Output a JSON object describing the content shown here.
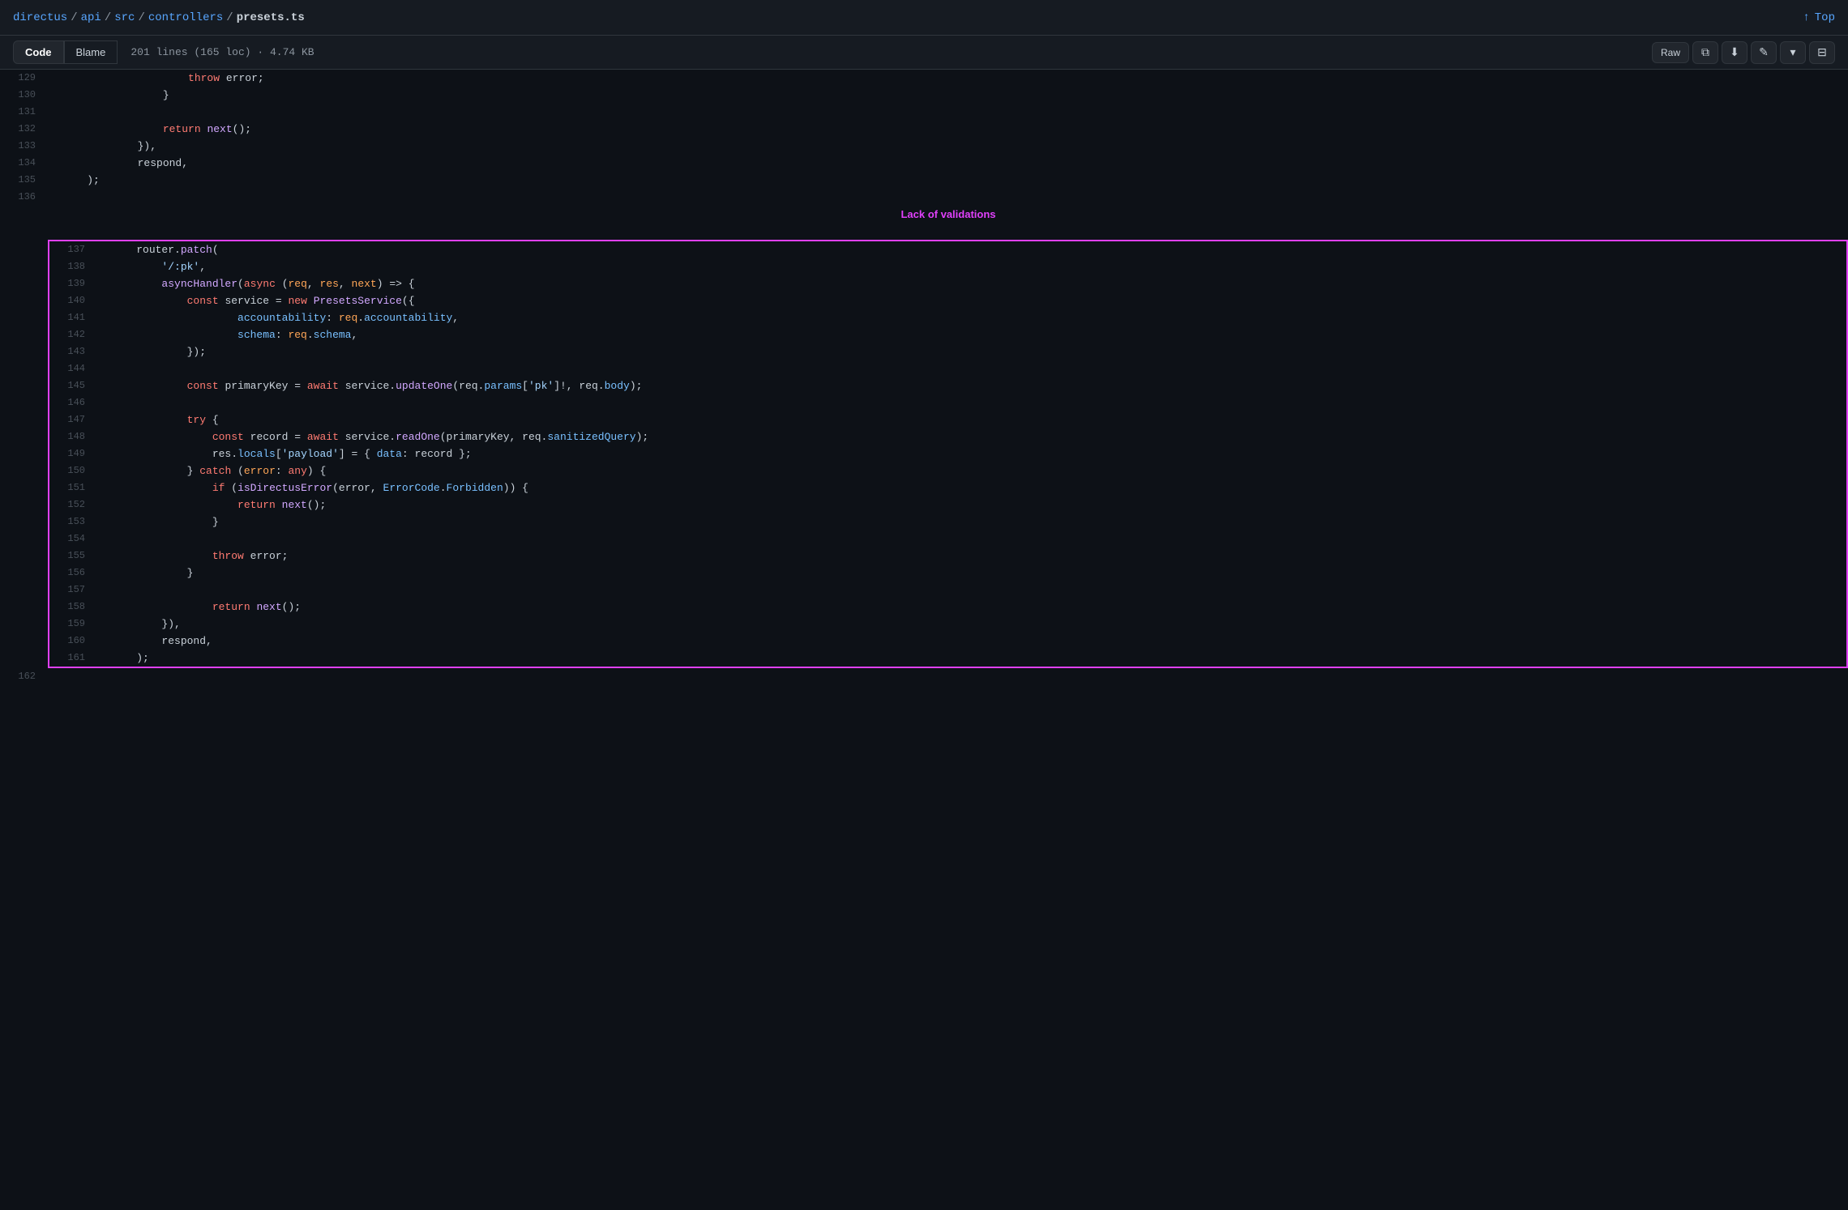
{
  "nav": {
    "breadcrumb": [
      {
        "label": "directus",
        "href": "#"
      },
      {
        "sep": "/"
      },
      {
        "label": "api",
        "href": "#"
      },
      {
        "sep": "/"
      },
      {
        "label": "src",
        "href": "#"
      },
      {
        "sep": "/"
      },
      {
        "label": "controllers",
        "href": "#"
      },
      {
        "sep": "/"
      },
      {
        "label": "presets.ts",
        "current": true
      }
    ],
    "top_link": "Top",
    "top_icon": "↑"
  },
  "toolbar": {
    "tab_code": "Code",
    "tab_blame": "Blame",
    "file_meta": "201 lines (165 loc) · 4.74 KB",
    "raw_btn": "Raw",
    "copy_icon": "⧉",
    "download_icon": "↓",
    "edit_icon": "✎",
    "dropdown_icon": "▾",
    "symbol_icon": "⊞"
  },
  "annotation": {
    "label": "Lack of validations"
  },
  "lines": [
    {
      "num": 129,
      "code": "                    throw error;",
      "highlight": false
    },
    {
      "num": 130,
      "code": "                }",
      "highlight": false
    },
    {
      "num": 131,
      "code": "",
      "highlight": false
    },
    {
      "num": 132,
      "code": "                return next();",
      "highlight": false
    },
    {
      "num": 133,
      "code": "            }),",
      "highlight": false
    },
    {
      "num": 134,
      "code": "            respond,",
      "highlight": false
    },
    {
      "num": 135,
      "code": "    );",
      "highlight": false
    },
    {
      "num": 136,
      "code": "",
      "highlight": false
    },
    {
      "num": 137,
      "code": "    router.patch(",
      "highlight": true,
      "box_start": true
    },
    {
      "num": 138,
      "code": "        '/:pk',",
      "highlight": true
    },
    {
      "num": 139,
      "code": "        asyncHandler(async (req, res, next) => {",
      "highlight": true
    },
    {
      "num": 140,
      "code": "            const service = new PresetsService({",
      "highlight": true
    },
    {
      "num": 141,
      "code": "                    accountability: req.accountability,",
      "highlight": true
    },
    {
      "num": 142,
      "code": "                    schema: req.schema,",
      "highlight": true
    },
    {
      "num": 143,
      "code": "            });",
      "highlight": true
    },
    {
      "num": 144,
      "code": "",
      "highlight": true
    },
    {
      "num": 145,
      "code": "            const primaryKey = await service.updateOne(req.params['pk']!, req.body);",
      "highlight": true
    },
    {
      "num": 146,
      "code": "",
      "highlight": true
    },
    {
      "num": 147,
      "code": "            try {",
      "highlight": true
    },
    {
      "num": 148,
      "code": "                const record = await service.readOne(primaryKey, req.sanitizedQuery);",
      "highlight": true
    },
    {
      "num": 149,
      "code": "                res.locals['payload'] = { data: record };",
      "highlight": true
    },
    {
      "num": 150,
      "code": "            } catch (error: any) {",
      "highlight": true
    },
    {
      "num": 151,
      "code": "                if (isDirectusError(error, ErrorCode.Forbidden)) {",
      "highlight": true
    },
    {
      "num": 152,
      "code": "                    return next();",
      "highlight": true
    },
    {
      "num": 153,
      "code": "                }",
      "highlight": true
    },
    {
      "num": 154,
      "code": "",
      "highlight": true
    },
    {
      "num": 155,
      "code": "                throw error;",
      "highlight": true
    },
    {
      "num": 156,
      "code": "            }",
      "highlight": true
    },
    {
      "num": 157,
      "code": "",
      "highlight": true
    },
    {
      "num": 158,
      "code": "                return next();",
      "highlight": true
    },
    {
      "num": 159,
      "code": "        }),",
      "highlight": true
    },
    {
      "num": 160,
      "code": "        respond,",
      "highlight": true
    },
    {
      "num": 161,
      "code": "    );",
      "highlight": true,
      "box_end": true
    },
    {
      "num": 162,
      "code": "",
      "highlight": false
    }
  ]
}
